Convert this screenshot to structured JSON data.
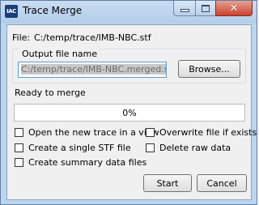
{
  "window": {
    "title": "Trace Merge",
    "app_icon_text": "IAC"
  },
  "file": {
    "label": "File:",
    "path": "C:/temp/trace/IMB-NBC.stf"
  },
  "output": {
    "group_label": "Output file name",
    "value": "C:/temp/trace/IMB-NBC.merged.stf",
    "browse_label": "Browse..."
  },
  "status": {
    "text": "Ready to merge"
  },
  "progress": {
    "value_percent": 0,
    "label": "0%"
  },
  "options": {
    "open_in_view": {
      "label": "Open the new trace in a view",
      "checked": false
    },
    "overwrite": {
      "label": "Overwrite file if exists",
      "checked": false
    },
    "single_stf": {
      "label": "Create a single STF file",
      "checked": false
    },
    "delete_raw": {
      "label": "Delete raw data",
      "checked": false
    },
    "summary": {
      "label": "Create summary data files",
      "checked": false
    }
  },
  "buttons": {
    "start": "Start",
    "cancel": "Cancel"
  },
  "colors": {
    "titlebar": "#bcd5ee",
    "close_button": "#c9432f",
    "progress_fill": "#06b025",
    "input_focus_border": "#5b9bd5"
  }
}
